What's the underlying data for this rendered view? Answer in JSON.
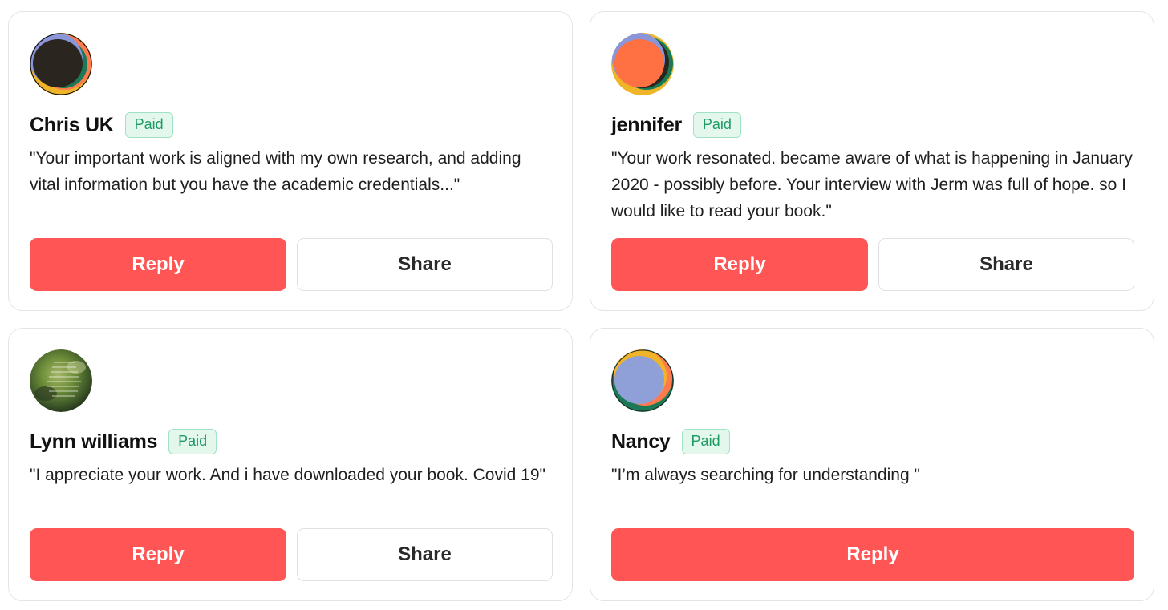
{
  "cards": [
    {
      "name": "Chris UK",
      "badge": "Paid",
      "quote": "\"Your important work is aligned with my own research, and adding vital information but you have the academic credentials...\"",
      "reply_label": "Reply",
      "share_label": "Share",
      "avatar_colors": [
        "#2b2520",
        "#f0b429",
        "#ff7a4d",
        "#1b7a55",
        "#8a96d8"
      ]
    },
    {
      "name": "jennifer",
      "badge": "Paid",
      "quote": "\"Your work resonated. became aware of what is happening in January 2020 - possibly before. Your interview with Jerm was full of hope. so I would like to read your book.\"",
      "reply_label": "Reply",
      "share_label": "Share",
      "avatar_colors": [
        "#ff7043",
        "#f0b429",
        "#1b7a55",
        "#2b2520",
        "#8a96d8"
      ]
    },
    {
      "name": "Lynn williams",
      "badge": "Paid",
      "quote": "\"I appreciate your work. And i have downloaded your book. Covid 19\"",
      "reply_label": "Reply",
      "share_label": "Share",
      "avatar_colors": [
        "#3f5a2a",
        "#6f8f3a",
        "#2e3d22",
        "#a7b86a"
      ]
    },
    {
      "name": "Nancy",
      "badge": "Paid",
      "quote": "\"I’m always searching for understanding \"",
      "reply_label": "Reply",
      "avatar_colors": [
        "#8f9fd8",
        "#f0b429",
        "#ff7a4d",
        "#1b7a55"
      ]
    }
  ],
  "colors": {
    "reply_button": "#ff5555",
    "badge_bg": "#e3f7ed",
    "badge_text": "#1e9a63",
    "card_border": "#e4e4e4"
  }
}
